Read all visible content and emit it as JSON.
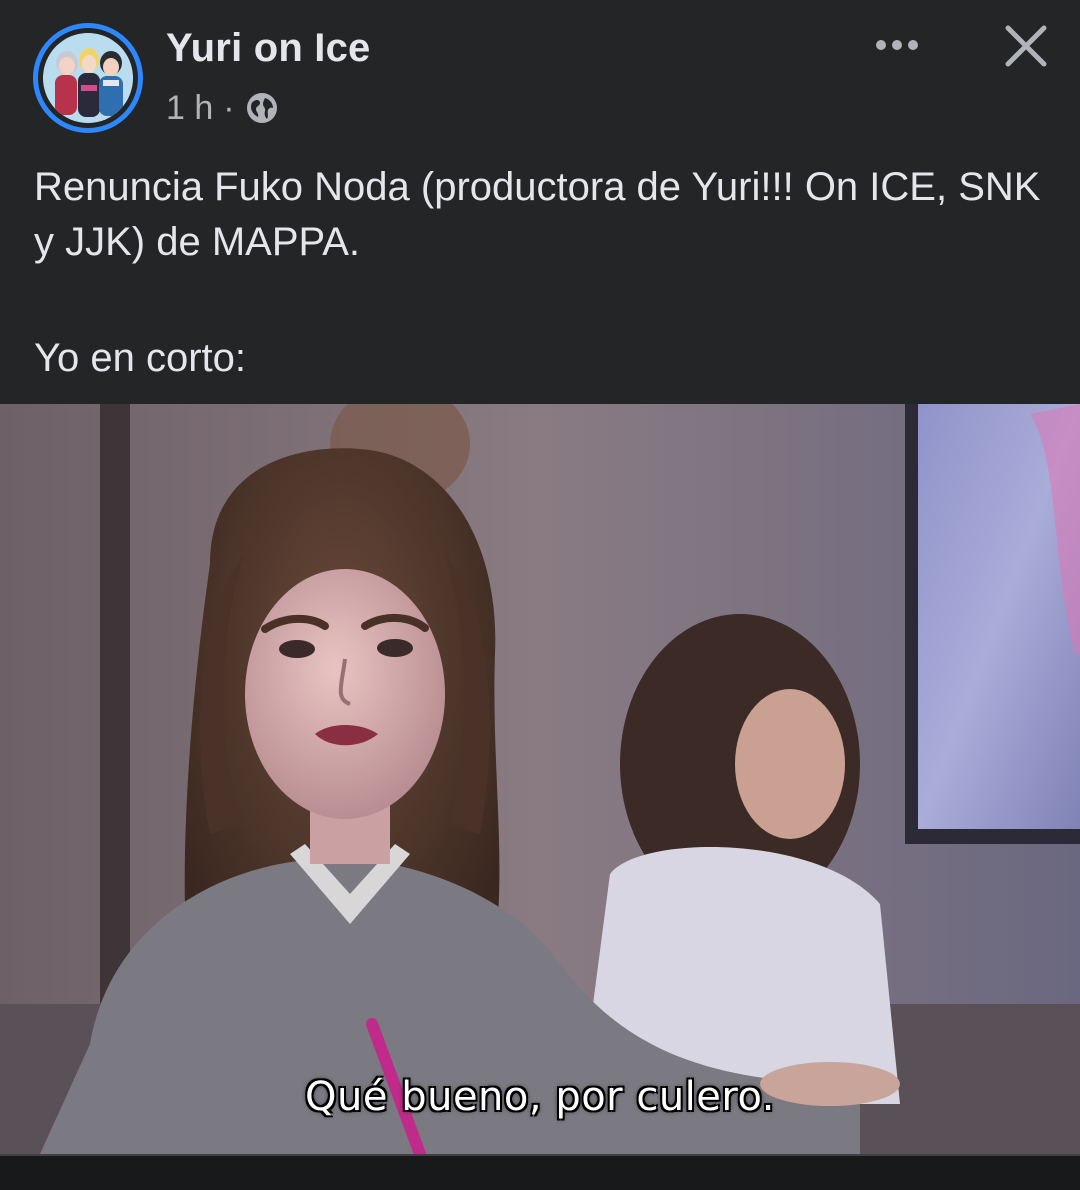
{
  "post": {
    "page_name": "Yuri on Ice",
    "time": "1 h",
    "separator": "·",
    "privacy_icon": "globe-icon",
    "text_line_1": "Renuncia Fuko Noda (productora de Yuri!!! On ICE, SNK y JJK) de MAPPA.",
    "text_line_2": "Yo en corto:"
  },
  "controls": {
    "more_icon": "more-horizontal-icon",
    "close_icon": "close-icon"
  },
  "meme": {
    "caption": "Qué bueno, por culero."
  },
  "colors": {
    "background": "#242526",
    "primary_text": "#e4e6eb",
    "secondary_text": "#b0b3b8",
    "avatar_ring": "#2d88ff"
  }
}
